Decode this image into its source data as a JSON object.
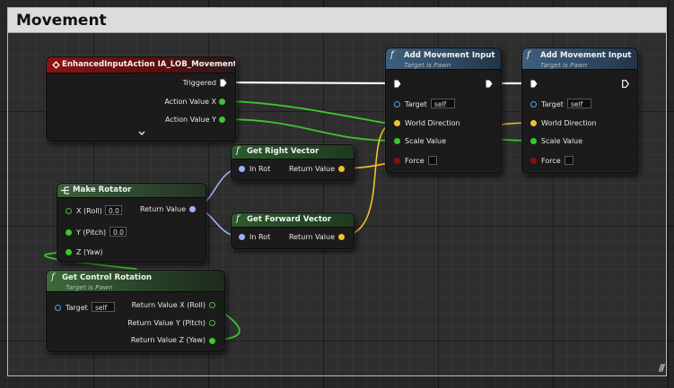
{
  "comment": {
    "title": "Movement",
    "grip": "///"
  },
  "input_action_node": {
    "title": "EnhancedInputAction IA_LOB_Movement",
    "pins": {
      "triggered": "Triggered",
      "action_value_x": "Action Value X",
      "action_value_y": "Action Value Y"
    },
    "expand_icon": "chevron-down"
  },
  "get_right_vector": {
    "title": "Get Right Vector",
    "in_label": "In Rot",
    "out_label": "Return Value"
  },
  "get_forward_vector": {
    "title": "Get Forward Vector",
    "in_label": "In Rot",
    "out_label": "Return Value"
  },
  "make_rotator": {
    "title": "Make Rotator",
    "x_label": "X (Roll)",
    "x_value": "0.0",
    "y_label": "Y (Pitch)",
    "y_value": "0.0",
    "z_label": "Z (Yaw)",
    "out_label": "Return Value"
  },
  "get_control_rotation": {
    "title": "Get Control Rotation",
    "subtitle": "Target is Pawn",
    "target_label": "Target",
    "target_value": "self",
    "out_x": "Return Value X (Roll)",
    "out_y": "Return Value Y (Pitch)",
    "out_z": "Return Value Z (Yaw)"
  },
  "add_movement_input_1": {
    "title": "Add Movement Input",
    "subtitle": "Target is Pawn",
    "target_label": "Target",
    "target_value": "self",
    "world_direction_label": "World Direction",
    "scale_value_label": "Scale Value",
    "force_label": "Force"
  },
  "add_movement_input_2": {
    "title": "Add Movement Input",
    "subtitle": "Target is Pawn",
    "target_label": "Target",
    "target_value": "self",
    "world_direction_label": "World Direction",
    "scale_value_label": "Scale Value",
    "force_label": "Force"
  },
  "colors": {
    "exec": "#ffffff",
    "float": "#3ec62e",
    "vector": "#f2c12e",
    "rotator": "#9fb2f5",
    "object": "#3fa9f5",
    "bool": "#8a0f0f",
    "event_header": "#8c1212",
    "function_header": "#3b5a78",
    "pure_header": "#2c5a2c"
  }
}
